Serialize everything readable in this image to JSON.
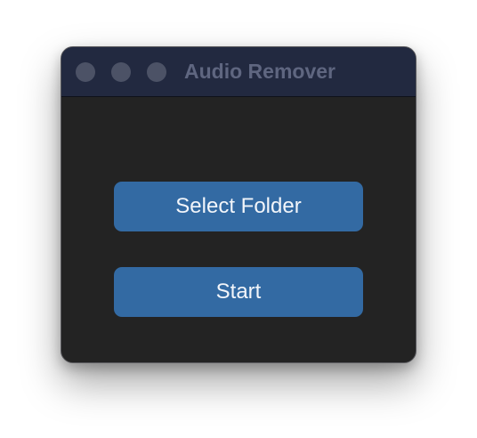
{
  "window": {
    "title": "Audio Remover"
  },
  "buttons": {
    "select_folder_label": "Select Folder",
    "start_label": "Start"
  },
  "colors": {
    "window_bg": "#232323",
    "titlebar_bg": "#222940",
    "title_text": "#5f6680",
    "traffic_light": "#4c5266",
    "button_bg": "#336aa3",
    "button_text": "#f2f5fa"
  }
}
